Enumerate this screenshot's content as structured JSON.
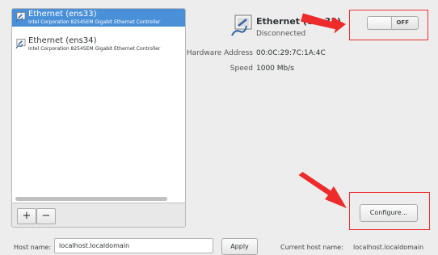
{
  "devices": [
    {
      "name": "Ethernet (ens33)",
      "description": "Intel Corporation 82545EM Gigabit Ethernet Controller",
      "selected": true
    },
    {
      "name": "Ethernet (ens34)",
      "description": "Intel Corporation 82545EM Gigabit Ethernet Controller",
      "selected": false
    }
  ],
  "list_toolbar": {
    "add_label": "+",
    "remove_label": "−"
  },
  "detail": {
    "title": "Ethernet (ens33)",
    "status": "Disconnected",
    "properties": [
      {
        "label": "Hardware Address",
        "value": "00:0C:29:7C:1A:4C"
      },
      {
        "label": "Speed",
        "value": "1000 Mb/s"
      }
    ]
  },
  "toggle": {
    "label": "OFF",
    "state": "off"
  },
  "configure_label": "Configure...",
  "hostname": {
    "label": "Host name:",
    "value": "localhost.localdomain",
    "apply_label": "Apply",
    "current_label": "Current host name:",
    "current_value": "localhost.localdomain"
  },
  "colors": {
    "selection": "#4a90d9",
    "annotation": "#ee3333"
  }
}
